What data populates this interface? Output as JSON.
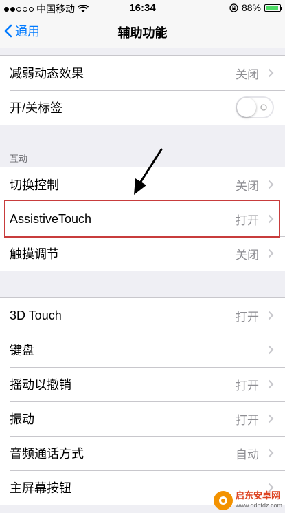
{
  "status_bar": {
    "carrier": "中国移动",
    "time": "16:34",
    "battery_percent": "88%",
    "battery_level": 0.88,
    "wifi_icon": "wifi-icon",
    "lock_icon": "rotation-lock-icon"
  },
  "nav": {
    "back_label": "通用",
    "title": "辅助功能"
  },
  "group1": [
    {
      "label": "减弱动态效果",
      "value": "关闭"
    },
    {
      "label": "开/关标签"
    }
  ],
  "section_header": "互动",
  "group2": [
    {
      "label": "切换控制",
      "value": "关闭"
    },
    {
      "label": "AssistiveTouch",
      "value": "打开"
    },
    {
      "label": "触摸调节",
      "value": "关闭"
    }
  ],
  "group3": [
    {
      "label": "3D Touch",
      "value": "打开"
    },
    {
      "label": "键盘",
      "value": ""
    },
    {
      "label": "摇动以撤销",
      "value": "打开"
    },
    {
      "label": "振动",
      "value": "打开"
    },
    {
      "label": "音频通话方式",
      "value": "自动"
    },
    {
      "label": "主屏幕按钮",
      "value": ""
    }
  ],
  "watermark": {
    "name": "启东安卓网",
    "url": "www.qdhtdz.com"
  },
  "colors": {
    "accent": "#007aff",
    "highlight_box": "#c83c3c",
    "battery_fill": "#4cd964"
  }
}
